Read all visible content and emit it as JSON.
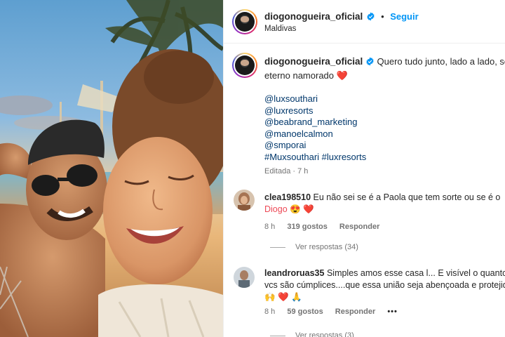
{
  "post": {
    "author": "diogonogueira_oficial",
    "follow_label": "Seguir",
    "separator": "•",
    "location": "Maldivas",
    "caption_line1": "Quero tudo junto, lado a lado, seu",
    "caption_line2": "eterno namorado",
    "caption_emoji": "❤️",
    "mentions": [
      "@luxsouthari",
      "@luxresorts",
      "@beabrand_marketing",
      "@manoelcalmon",
      "@smporai",
      "#Muxsouthari #luxresorts"
    ],
    "edited": "Editada · 7 h"
  },
  "comments": [
    {
      "user": "clea198510",
      "text_line1": "Eu não sei se é a Paola que tem sorte ou se é o",
      "text_line2": "Diogo 😍 ❤️",
      "time": "8 h",
      "likes": "319 gostos",
      "reply": "Responder",
      "view_replies": "Ver respostas (34)"
    },
    {
      "user": "leandroruas35",
      "text_line1": "Simples amos esse casa l... E visível o quanto",
      "text_line2": "vcs são cúmplices....que essa união seja abençoada e protejid",
      "text_line3": "🙌 ❤️ 🙏",
      "time": "8 h",
      "likes": "59 gostos",
      "reply": "Responder",
      "more": "•••",
      "view_replies": "Ver respostas (3)"
    }
  ],
  "colors": {
    "link": "#00376b",
    "follow": "#0095f6",
    "verified": "#0095f6",
    "meta": "#737373"
  },
  "icons": {
    "verified": "verified-badge-icon"
  }
}
